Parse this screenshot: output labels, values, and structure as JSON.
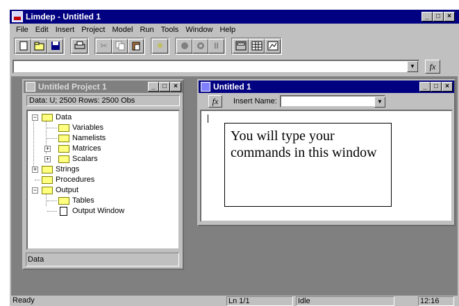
{
  "app": {
    "title": "Limdep - Untitled 1"
  },
  "menu": [
    "File",
    "Edit",
    "Insert",
    "Project",
    "Model",
    "Run",
    "Tools",
    "Window",
    "Help"
  ],
  "toolbar": {
    "icons": [
      "new-file-icon",
      "open-folder-icon",
      "save-icon",
      "print-icon",
      "cut-icon",
      "copy-icon",
      "paste-icon",
      "run-star-icon",
      "record-icon",
      "stop-icon",
      "pause-icon",
      "calculator-icon",
      "data-grid-icon",
      "chart-icon"
    ]
  },
  "command": {
    "value": "",
    "fx_label": "fx"
  },
  "project": {
    "title": "Untitled Project 1",
    "info": "Data: U; 2500 Rows: 2500 Obs",
    "tree": [
      {
        "label": "Data",
        "expander": "−"
      },
      {
        "label": "Variables"
      },
      {
        "label": "Namelists"
      },
      {
        "label": "Matrices",
        "expander": "+"
      },
      {
        "label": "Scalars",
        "expander": "+"
      },
      {
        "label": "Strings",
        "expander": "+"
      },
      {
        "label": "Procedures"
      },
      {
        "label": "Output",
        "expander": "−"
      },
      {
        "label": "Tables"
      },
      {
        "label": "Output Window"
      }
    ],
    "status": "Data"
  },
  "editor": {
    "title": "Untitled 1",
    "fx_label": "fx",
    "insert_name_label": "Insert Name:",
    "insert_name_value": "",
    "annotation": "You will type your commands in this window"
  },
  "status": {
    "ready": "Ready",
    "position": "Ln 1/1",
    "state": "Idle",
    "time": "12:16"
  }
}
